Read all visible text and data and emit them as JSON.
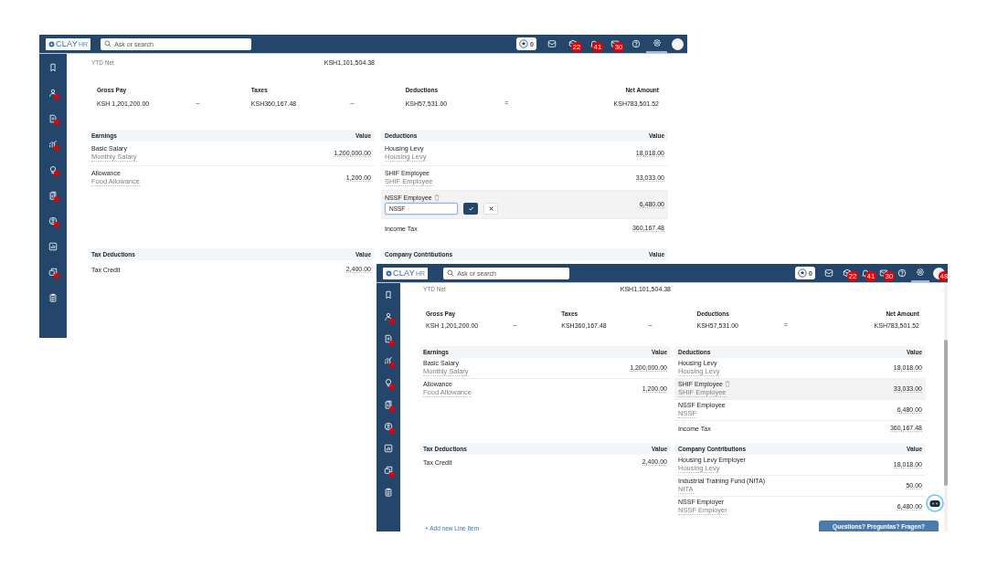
{
  "windows": [
    {
      "kind": "back",
      "topbar": {
        "logo": "CLAY",
        "logo_suffix": "HR",
        "search_placeholder": "Ask or search",
        "items": [
          {
            "kind": "star",
            "count": "0",
            "selected": false
          },
          {
            "kind": "inbox",
            "selected": false
          },
          {
            "kind": "box",
            "badge": "22",
            "selected": false
          },
          {
            "kind": "bell",
            "badge": "41",
            "selected": false
          },
          {
            "kind": "mail",
            "badge": "30",
            "selected": false
          },
          {
            "kind": "help",
            "selected": false
          },
          {
            "kind": "settings",
            "selected": true
          },
          {
            "kind": "avatar",
            "selected": false
          }
        ]
      },
      "sidebar": {
        "items": [
          {
            "kind": "bookmark",
            "alert": false
          },
          {
            "kind": "users",
            "alert": true
          },
          {
            "kind": "document",
            "alert": true
          },
          {
            "kind": "growth",
            "alert": true
          },
          {
            "kind": "bulb",
            "alert": true
          },
          {
            "kind": "report",
            "alert": true
          },
          {
            "kind": "person",
            "alert": true
          },
          {
            "kind": "bars",
            "alert": false
          },
          {
            "kind": "stack",
            "alert": true
          },
          {
            "kind": "clipboard",
            "alert": false
          }
        ]
      },
      "ytd": {
        "label": "YTD Net",
        "value": "KSH1,101,504.38"
      },
      "summary": [
        {
          "kind": "amount",
          "label": "Gross Pay",
          "value": "KSH 1,201,200.00"
        },
        {
          "kind": "operator",
          "symbol": "–"
        },
        {
          "kind": "amount",
          "label": "Taxes",
          "value": "KSH360,167.48"
        },
        {
          "kind": "operator",
          "symbol": "–"
        },
        {
          "kind": "amount",
          "label": "Deductions",
          "value": "KSH57,531.00"
        },
        {
          "kind": "operator",
          "symbol": "="
        },
        {
          "kind": "amount",
          "label": "Net Amount",
          "value": "KSH783,501.52"
        }
      ],
      "tables": [
        {
          "title": "Earnings",
          "value_heading": "Value",
          "rows": [
            {
              "name": "Basic Salary",
              "note": "Monthly Salary",
              "value": "1,200,000.00",
              "hovered": false,
              "editing": false
            },
            {
              "name": "Allowance",
              "note": "Food Allowance",
              "value": "1,200.00",
              "hovered": false,
              "editing": false
            }
          ]
        },
        {
          "title": "Deductions",
          "value_heading": "Value",
          "rows": [
            {
              "name": "Housing Levy",
              "note": "Housing Levy",
              "value": "18,018.00",
              "hovered": false,
              "editing": false
            },
            {
              "name": "SHIF Employee",
              "note": "SHIF Employee",
              "value": "33,033.00",
              "hovered": false,
              "editing": false
            },
            {
              "name": "NSSF Employee",
              "input_value": "NSSF",
              "value": "6,480.00",
              "hovered": true,
              "editing": true
            },
            {
              "name": "Income Tax",
              "value": "360,167.48",
              "hovered": false,
              "editing": false
            }
          ]
        },
        {
          "title": "Tax Deductions",
          "value_heading": "Value",
          "rows": [
            {
              "name": "Tax Credit",
              "value": "2,400.00",
              "hovered": false,
              "editing": false
            }
          ]
        },
        {
          "title": "Company Contributions",
          "value_heading": "Value"
        }
      ]
    },
    {
      "kind": "front",
      "topbar": {
        "logo": "CLAY",
        "logo_suffix": "HR",
        "search_placeholder": "Ask or search",
        "items": [
          {
            "kind": "star",
            "count": "0",
            "selected": false
          },
          {
            "kind": "inbox",
            "selected": false
          },
          {
            "kind": "box",
            "badge": "22",
            "selected": false
          },
          {
            "kind": "bell",
            "badge": "41",
            "selected": false
          },
          {
            "kind": "mail",
            "badge": "30",
            "selected": false
          },
          {
            "kind": "help",
            "selected": false
          },
          {
            "kind": "settings",
            "selected": true
          },
          {
            "kind": "avatar",
            "badge": "48",
            "selected": false
          }
        ]
      },
      "sidebar": {
        "items": [
          {
            "kind": "bookmark",
            "alert": false
          },
          {
            "kind": "users",
            "alert": true
          },
          {
            "kind": "document",
            "alert": true
          },
          {
            "kind": "growth",
            "alert": true
          },
          {
            "kind": "bulb",
            "alert": true
          },
          {
            "kind": "report",
            "alert": true
          },
          {
            "kind": "person",
            "alert": true
          },
          {
            "kind": "bars",
            "alert": false
          },
          {
            "kind": "stack",
            "alert": true
          },
          {
            "kind": "clipboard",
            "alert": false
          }
        ]
      },
      "ytd": {
        "label": "YTD Net",
        "value": "KSH1,101,504.38"
      },
      "summary": [
        {
          "kind": "amount",
          "label": "Gross Pay",
          "value": "KSH 1,201,200.00"
        },
        {
          "kind": "operator",
          "symbol": "–"
        },
        {
          "kind": "amount",
          "label": "Taxes",
          "value": "KSH360,167.48"
        },
        {
          "kind": "operator",
          "symbol": "–"
        },
        {
          "kind": "amount",
          "label": "Deductions",
          "value": "KSH57,531.00"
        },
        {
          "kind": "operator",
          "symbol": "="
        },
        {
          "kind": "amount",
          "label": "Net Amount",
          "value": "KSH783,501.52"
        }
      ],
      "tables": [
        {
          "title": "Earnings",
          "value_heading": "Value",
          "rows": [
            {
              "name": "Basic Salary",
              "note": "Monthly Salary",
              "value": "1,200,000.00",
              "hovered": false,
              "editing": false
            },
            {
              "name": "Allowance",
              "note": "Food Allowance",
              "value": "1,200.00",
              "hovered": false,
              "editing": false
            }
          ]
        },
        {
          "title": "Deductions",
          "value_heading": "Value",
          "rows": [
            {
              "name": "Housing Levy",
              "note": "Housing Levy",
              "value": "18,018.00",
              "hovered": false,
              "editing": false
            },
            {
              "name": "SHIF Employee",
              "note": "SHIF Employee",
              "value": "33,033.00",
              "hovered": true,
              "editing": false
            },
            {
              "name": "NSSF Employee",
              "note": "NSSF",
              "value": "6,480.00",
              "hovered": false,
              "editing": false
            },
            {
              "name": "Income Tax",
              "value": "360,167.48",
              "hovered": false,
              "editing": false
            }
          ]
        },
        {
          "title": "Tax Deductions",
          "value_heading": "Value",
          "rows": [
            {
              "name": "Tax Credit",
              "value": "2,400.00",
              "hovered": false,
              "editing": false
            }
          ]
        },
        {
          "title": "Company Contributions",
          "value_heading": "Value",
          "rows": [
            {
              "name": "Housing Levy Employer",
              "note": "Housing Levy",
              "value": "18,018.00",
              "hovered": false,
              "editing": false
            },
            {
              "name": "Industrial Training Fund (NITA)",
              "note": "NITA",
              "value": "50.00",
              "hovered": false,
              "editing": false
            },
            {
              "name": "NSSF Employer",
              "note": "NSSF Employer",
              "value": "6,480.00",
              "hovered": false,
              "editing": false
            }
          ]
        }
      ],
      "add_link": "+ Add new Line Item",
      "chat_button": "Questions? Preguntas? Fragen?"
    }
  ]
}
